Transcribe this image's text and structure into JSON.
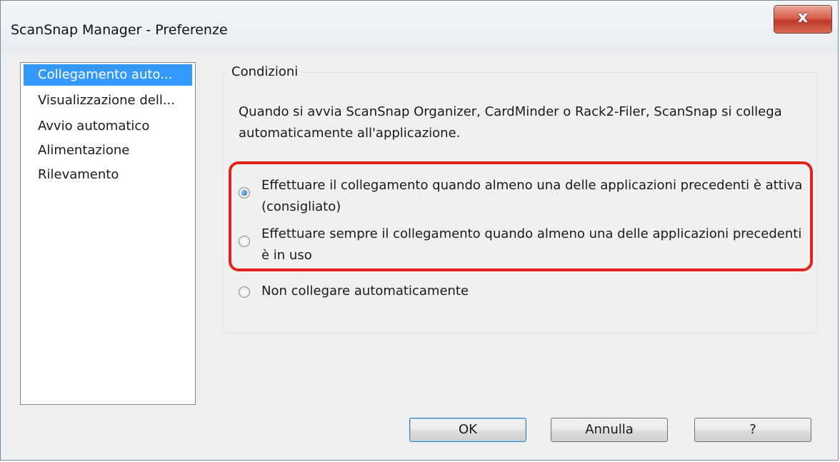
{
  "window": {
    "title": "ScanSnap Manager - Preferenze",
    "close_label": "x"
  },
  "sidebar": {
    "items": [
      {
        "label": "Collegamento auto...",
        "selected": true
      },
      {
        "label": "Visualizzazione dell...",
        "selected": false
      },
      {
        "label": "Avvio automatico",
        "selected": false
      },
      {
        "label": "Alimentazione",
        "selected": false
      },
      {
        "label": "Rilevamento",
        "selected": false
      }
    ]
  },
  "conditions": {
    "group_title": "Condizioni",
    "description": "Quando si avvia ScanSnap Organizer, CardMinder o Rack2-Filer, ScanSnap si collega automaticamente all'applicazione.",
    "options": [
      {
        "label": "Effettuare il collegamento quando almeno una delle applicazioni precedenti è attiva (consigliato)",
        "checked": true
      },
      {
        "label": "Effettuare sempre il collegamento quando almeno una delle applicazioni precedenti è in uso",
        "checked": false
      },
      {
        "label": "Non collegare automaticamente",
        "checked": false
      }
    ]
  },
  "buttons": {
    "ok": "OK",
    "cancel": "Annulla",
    "help": "?"
  },
  "colors": {
    "selection": "#3399ff",
    "highlight_border": "#e2231a",
    "close_button": "#c0392b"
  }
}
